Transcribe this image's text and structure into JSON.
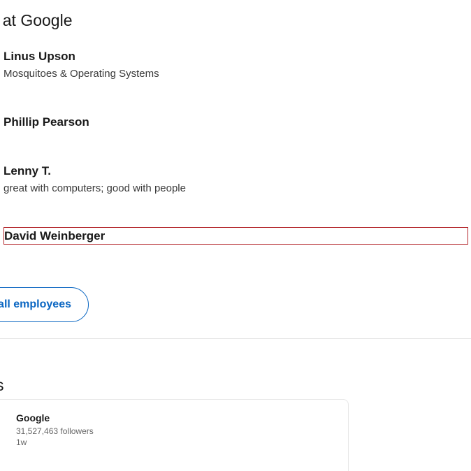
{
  "employees_section": {
    "heading": "oyees at Google",
    "employees": [
      {
        "name": "Linus Upson",
        "headline": "Mosquitoes & Operating Systems"
      },
      {
        "name": "Phillip Pearson",
        "headline": ""
      },
      {
        "name": "Lenny T.",
        "headline": "great with computers; good with people"
      },
      {
        "name": "David Weinberger",
        "headline": ""
      }
    ],
    "show_all_label": "all employees"
  },
  "updates_section": {
    "heading": "ates",
    "card": {
      "company": "Google",
      "followers": "31,527,463 followers",
      "time": "1w"
    }
  },
  "colors": {
    "accent": "#0a66c2",
    "focus_outline": "#b3262b",
    "text_primary": "#191919",
    "text_secondary": "#666666"
  }
}
